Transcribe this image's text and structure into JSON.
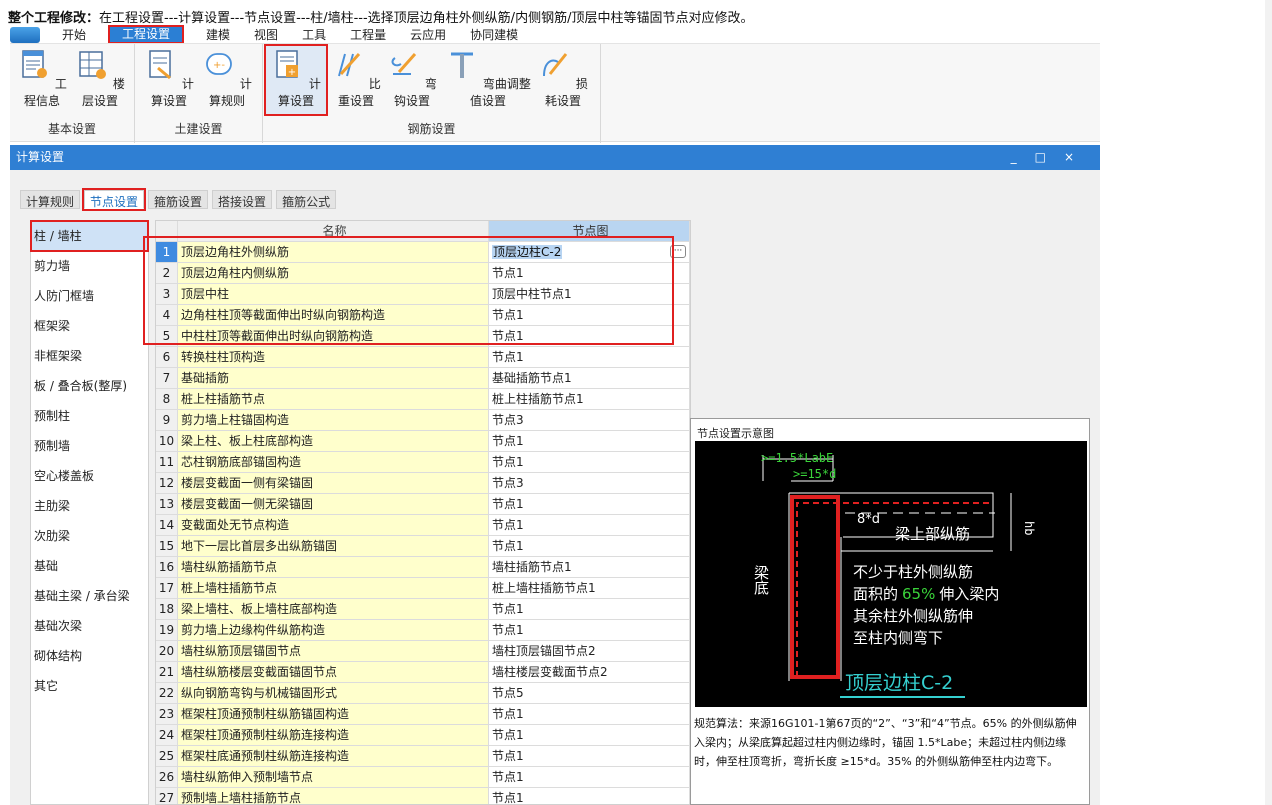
{
  "header_note": {
    "bold": "整个工程修改：",
    "text": "在工程设置---计算设置---节点设置---柱/墙柱---选择顶层边角柱外侧纵筋/内侧钢筋/顶层中柱等锚固节点对应修改。"
  },
  "menubar": {
    "items": [
      "开始",
      "工程设置",
      "建模",
      "视图",
      "工具",
      "工程量",
      "云应用",
      "协同建模"
    ],
    "active_index": 1
  },
  "ribbon": {
    "groups": [
      {
        "label": "基本设置",
        "buttons": [
          "工程信息",
          "楼层设置"
        ]
      },
      {
        "label": "土建设置",
        "buttons": [
          "计算设置",
          "计算规则"
        ]
      },
      {
        "label": "钢筋设置",
        "buttons": [
          "计算设置",
          "比重设置",
          "弯钩设置",
          "弯曲调整值设置",
          "损耗设置"
        ]
      }
    ],
    "highlighted": "钢筋设置/计算设置"
  },
  "dialog": {
    "title": "计算设置",
    "controls": [
      "_",
      "□",
      "×"
    ]
  },
  "tabs": {
    "items": [
      "计算规则",
      "节点设置",
      "箍筋设置",
      "搭接设置",
      "箍筋公式"
    ],
    "active_index": 1
  },
  "left_list": {
    "items": [
      "柱 / 墙柱",
      "剪力墙",
      "人防门框墙",
      "框架梁",
      "非框架梁",
      "板 / 叠合板(整厚)",
      "预制柱",
      "预制墙",
      "空心楼盖板",
      "主肋梁",
      "次肋梁",
      "基础",
      "基础主梁 / 承台梁",
      "基础次梁",
      "砌体结构",
      "其它"
    ],
    "active_index": 0
  },
  "grid": {
    "columns": [
      "名称",
      "节点图"
    ],
    "rows": [
      {
        "num": "1",
        "name": "顶层边角柱外侧纵筋",
        "node": "顶层边柱C-2"
      },
      {
        "num": "2",
        "name": "顶层边角柱内侧纵筋",
        "node": "节点1"
      },
      {
        "num": "3",
        "name": "顶层中柱",
        "node": "顶层中柱节点1"
      },
      {
        "num": "4",
        "name": "边角柱柱顶等截面伸出时纵向钢筋构造",
        "node": "节点1"
      },
      {
        "num": "5",
        "name": "中柱柱顶等截面伸出时纵向钢筋构造",
        "node": "节点1"
      },
      {
        "num": "6",
        "name": "转换柱柱顶构造",
        "node": "节点1"
      },
      {
        "num": "7",
        "name": "基础插筋",
        "node": "基础插筋节点1"
      },
      {
        "num": "8",
        "name": "桩上柱插筋节点",
        "node": "桩上柱插筋节点1"
      },
      {
        "num": "9",
        "name": "剪力墙上柱锚固构造",
        "node": "节点3"
      },
      {
        "num": "10",
        "name": "梁上柱、板上柱底部构造",
        "node": "节点1"
      },
      {
        "num": "11",
        "name": "芯柱钢筋底部锚固构造",
        "node": "节点1"
      },
      {
        "num": "12",
        "name": "楼层变截面一侧有梁锚固",
        "node": "节点3"
      },
      {
        "num": "13",
        "name": "楼层变截面一侧无梁锚固",
        "node": "节点1"
      },
      {
        "num": "14",
        "name": "变截面处无节点构造",
        "node": "节点1"
      },
      {
        "num": "15",
        "name": "地下一层比首层多出纵筋锚固",
        "node": "节点1"
      },
      {
        "num": "16",
        "name": "墙柱纵筋插筋节点",
        "node": "墙柱插筋节点1"
      },
      {
        "num": "17",
        "name": "桩上墙柱插筋节点",
        "node": "桩上墙柱插筋节点1"
      },
      {
        "num": "18",
        "name": "梁上墙柱、板上墙柱底部构造",
        "node": "节点1"
      },
      {
        "num": "19",
        "name": "剪力墙上边缘构件纵筋构造",
        "node": "节点1"
      },
      {
        "num": "20",
        "name": "墙柱纵筋顶层锚固节点",
        "node": "墙柱顶层锚固节点2"
      },
      {
        "num": "21",
        "name": "墙柱纵筋楼层变截面锚固节点",
        "node": "墙柱楼层变截面节点2"
      },
      {
        "num": "22",
        "name": "纵向钢筋弯钩与机械锚固形式",
        "node": "节点5"
      },
      {
        "num": "23",
        "name": "框架柱顶通预制柱纵筋锚固构造",
        "node": "节点1"
      },
      {
        "num": "24",
        "name": "框架柱顶通预制柱纵筋连接构造",
        "node": "节点1"
      },
      {
        "num": "25",
        "name": "框架柱底通预制柱纵筋连接构造",
        "node": "节点1"
      },
      {
        "num": "26",
        "name": "墙柱纵筋伸入预制墙节点",
        "node": "节点1"
      },
      {
        "num": "27",
        "name": "预制墙上墙柱插筋节点",
        "node": "节点1"
      }
    ],
    "selected_index": 0
  },
  "preview": {
    "title": "节点设置示意图",
    "image": {
      "label_labe": ">=1.5*LabE",
      "label_15d": ">=15*d",
      "label_8d": "8*d",
      "label_hb": "hb",
      "beam_top_bar": "梁上部纵筋",
      "beam_bottom": "梁底",
      "desc_line1": "不少于柱外侧纵筋",
      "desc_line2_a": "面积的",
      "desc_line2_pct": "65%",
      "desc_line2_b": "伸入梁内",
      "desc_line3": "其余柱外侧纵筋伸",
      "desc_line4": "至柱内侧弯下",
      "caption": "顶层边柱C-2",
      "colors": {
        "background": "#000000",
        "column": "#e02020",
        "text": "#ffffff",
        "caption": "#35d0d0",
        "percent": "#3ad43a"
      }
    },
    "description": "规范算法：来源16G101-1第67页的“2”、“3”和“4”节点。65% 的外侧纵筋伸入梁内；从梁底算起超过柱内侧边缘时，锚固 1.5*Labe；未超过柱内侧边缘时，伸至柱顶弯折，弯折长度 ≥15*d。35% 的外侧纵筋伸至柱内边弯下。"
  },
  "colors": {
    "accent": "#2f7fd3",
    "highlight_border": "#e02020",
    "name_col_bg": "#ffffcc",
    "header_node_bg": "#b9d5f1"
  }
}
